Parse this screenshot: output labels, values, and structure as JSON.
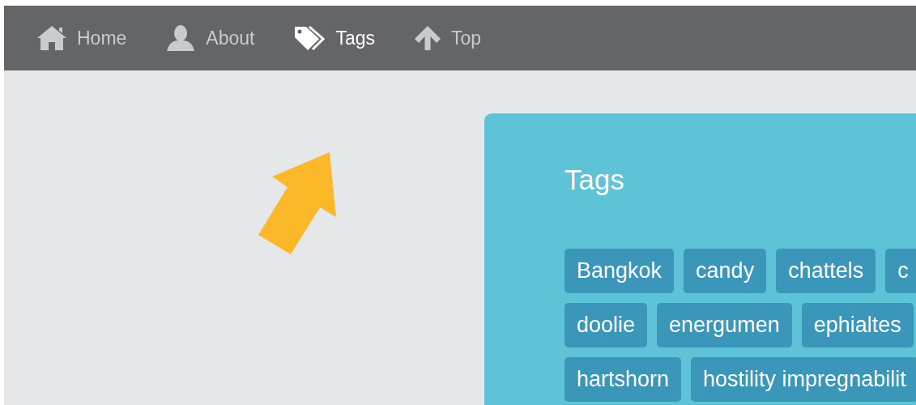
{
  "nav": {
    "items": [
      {
        "label": "Home",
        "selected": false
      },
      {
        "label": "About",
        "selected": false
      },
      {
        "label": "Tags",
        "selected": true
      },
      {
        "label": "Top",
        "selected": false
      }
    ]
  },
  "panel": {
    "title": "Tags",
    "tag_rows": [
      [
        "Bangkok",
        "candy",
        "chattels",
        "c"
      ],
      [
        "doolie",
        "energumen",
        "ephialtes"
      ],
      [
        "hartshorn",
        "hostility impregnabilit"
      ]
    ]
  }
}
